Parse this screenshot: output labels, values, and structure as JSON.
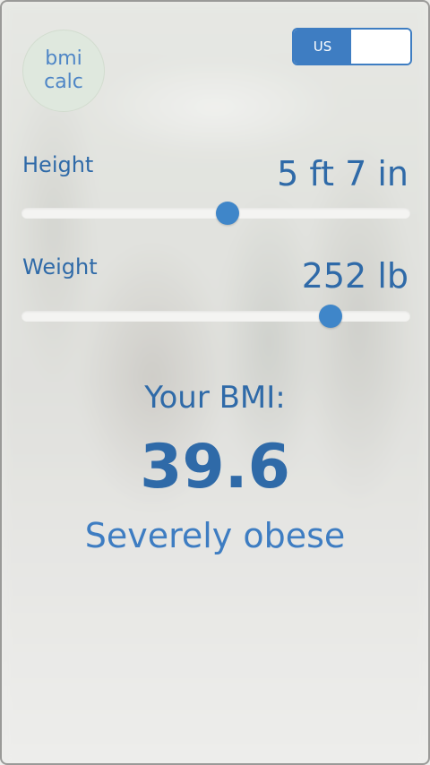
{
  "logo": {
    "line1": "bmi",
    "line2": "calc"
  },
  "unit_toggle": {
    "selected_label": "US",
    "accent_color": "#3e7dc2"
  },
  "height": {
    "label": "Height",
    "value": "5 ft 7 in",
    "slider_fraction": 0.53
  },
  "weight": {
    "label": "Weight",
    "value": "252 lb",
    "slider_fraction": 0.795
  },
  "result": {
    "title": "Your BMI:",
    "value": "39.6",
    "classification": "Severely obese"
  }
}
